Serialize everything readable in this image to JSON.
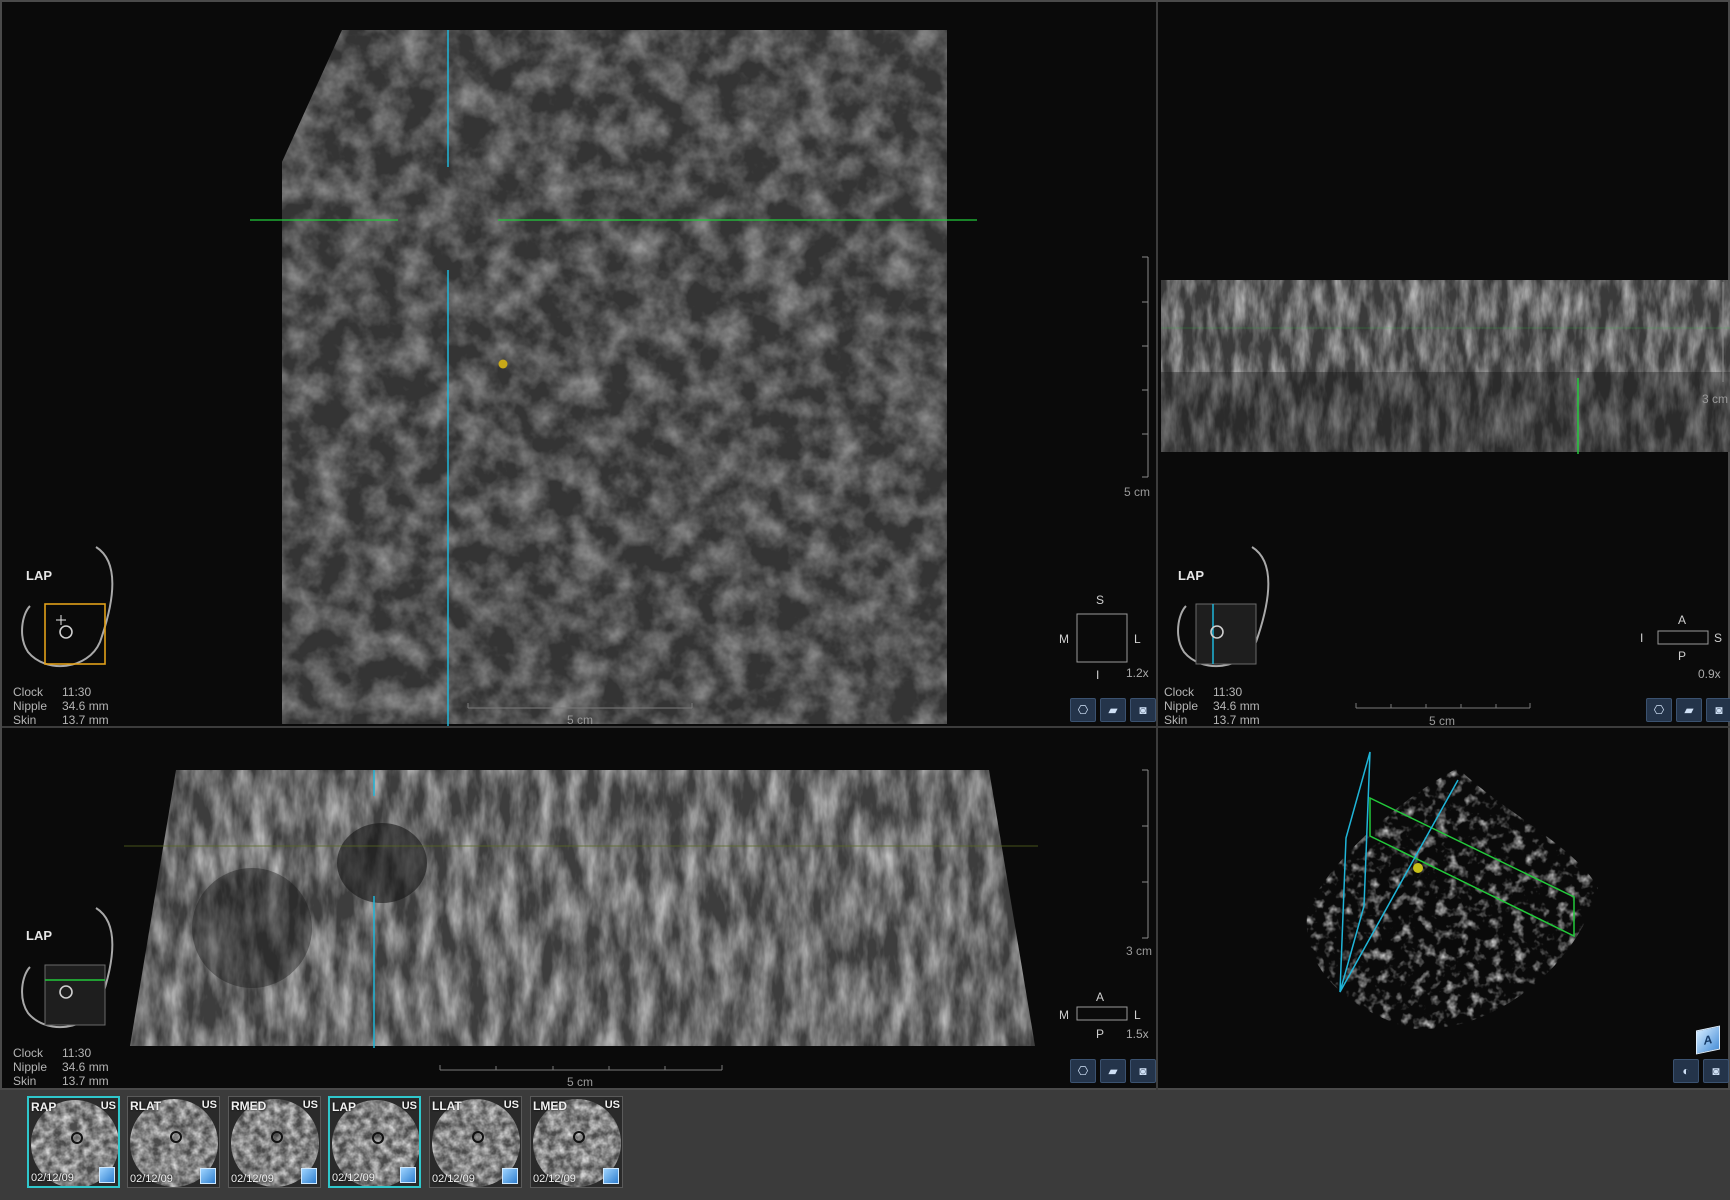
{
  "panes": {
    "coronal": {
      "view_label": "LAP",
      "clock_label": "Clock",
      "clock_value": "11:30",
      "nipple_label": "Nipple",
      "nipple_value": "34.6 mm",
      "skin_label": "Skin",
      "skin_value": "13.7 mm",
      "horizontal_scale": "5 cm",
      "vertical_scale": "5 cm",
      "orientation": {
        "top": "S",
        "left": "M",
        "right": "L",
        "bottom": "I"
      },
      "zoom": "1.2x"
    },
    "sagittal": {
      "view_label": "LAP",
      "clock_label": "Clock",
      "clock_value": "11:30",
      "nipple_label": "Nipple",
      "nipple_value": "34.6 mm",
      "skin_label": "Skin",
      "skin_value": "13.7 mm",
      "horizontal_scale": "5 cm",
      "vertical_scale": "3 cm",
      "orientation": {
        "top": "A",
        "left": "I",
        "right": "S",
        "bottom": "P"
      },
      "zoom": "0.9x"
    },
    "transverse": {
      "view_label": "LAP",
      "clock_label": "Clock",
      "clock_value": "11:30",
      "nipple_label": "Nipple",
      "nipple_value": "34.6 mm",
      "skin_label": "Skin",
      "skin_value": "13.7 mm",
      "horizontal_scale": "5 cm",
      "vertical_scale": "3 cm",
      "orientation": {
        "top": "A",
        "left": "M",
        "right": "L",
        "bottom": "P"
      },
      "zoom": "1.5x"
    },
    "volume3d": {
      "cube_label": "A"
    }
  },
  "colors": {
    "crosshair_blue": "#1fb5d8",
    "crosshair_green": "#22c93a",
    "marker_yellow": "#c8a818",
    "active_thumb_border": "#2fc7cc"
  },
  "thumbnails": [
    {
      "view": "RAP",
      "modality": "US",
      "date": "02/12/09",
      "active": true
    },
    {
      "view": "RLAT",
      "modality": "US",
      "date": "02/12/09",
      "active": false
    },
    {
      "view": "RMED",
      "modality": "US",
      "date": "02/12/09",
      "active": false
    },
    {
      "view": "LAP",
      "modality": "US",
      "date": "02/12/09",
      "active": true
    },
    {
      "view": "LLAT",
      "modality": "US",
      "date": "02/12/09",
      "active": false
    },
    {
      "view": "LMED",
      "modality": "US",
      "date": "02/12/09",
      "active": false
    }
  ]
}
